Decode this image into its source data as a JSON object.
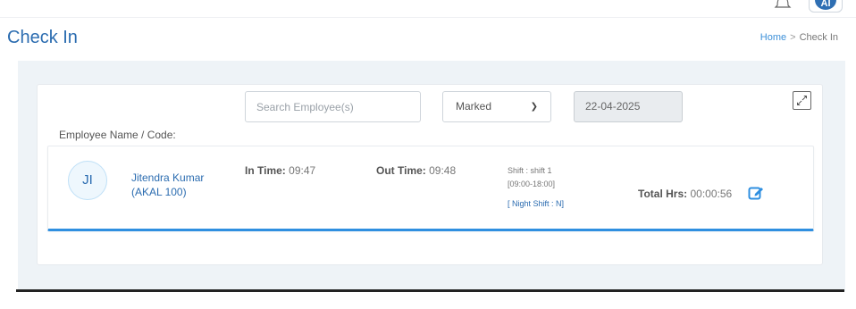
{
  "header": {
    "notification_icon": "bell-icon",
    "user_initials": "AI"
  },
  "page": {
    "title": "Check In",
    "breadcrumb": {
      "home": "Home",
      "separator": ">",
      "current": "Check In"
    }
  },
  "filters": {
    "employee_label": "Employee Name / Code:",
    "search_placeholder": "Search Employee(s)",
    "status_selected": "Marked",
    "date": "22-04-2025"
  },
  "record": {
    "initials": "JI",
    "name_line1": "Jitendra Kumar",
    "name_line2": "(AKAL 100)",
    "in_time_label": "In Time:",
    "in_time": "09:47",
    "out_time_label": "Out Time:",
    "out_time": "09:48",
    "shift_line1": "Shift : shift 1",
    "shift_line2": "[09:00-18:00]",
    "night_shift": "[ Night Shift : N]",
    "total_label": "Total Hrs:",
    "total_hours": "00:00:56"
  },
  "colors": {
    "accent": "#2b6cb0",
    "underline": "#2f8fe0",
    "panel_bg": "#eef3f7"
  }
}
